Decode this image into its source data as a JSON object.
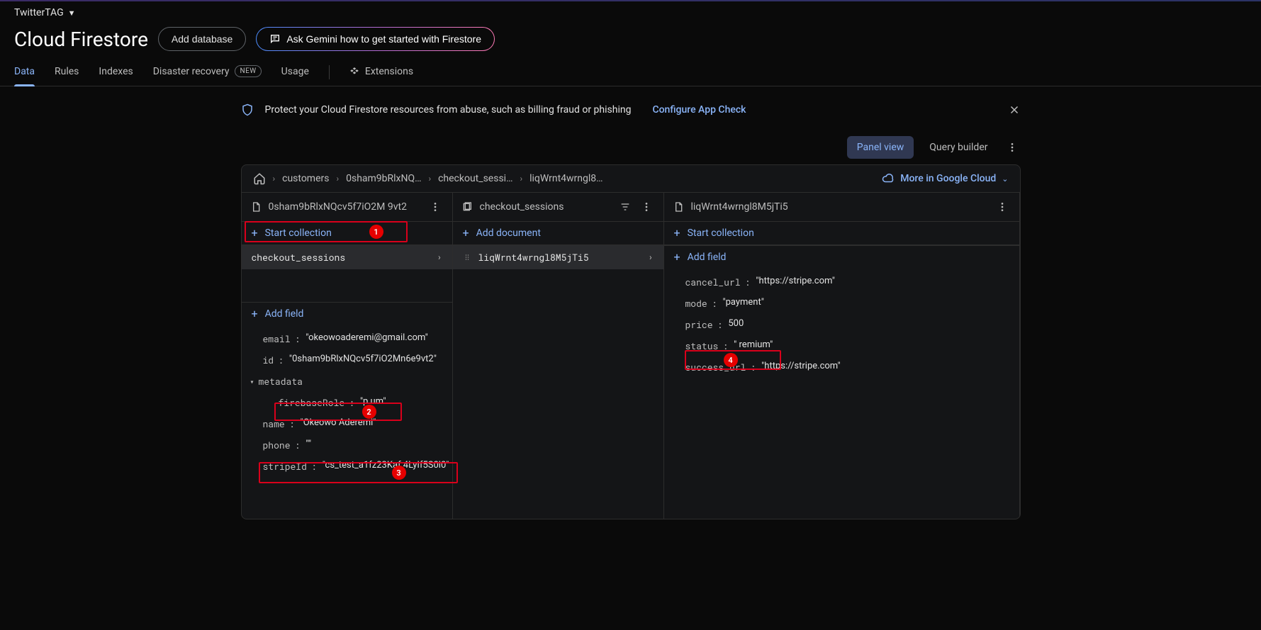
{
  "project": {
    "name": "TwitterTAG"
  },
  "page": {
    "title": "Cloud Firestore",
    "add_db": "Add database",
    "ask_gemini": "Ask Gemini how to get started with Firestore"
  },
  "tabs": {
    "data": "Data",
    "rules": "Rules",
    "indexes": "Indexes",
    "disaster": "Disaster recovery",
    "disaster_badge": "NEW",
    "usage": "Usage",
    "extensions": "Extensions"
  },
  "banner": {
    "text": "Protect your Cloud Firestore resources from abuse, such as billing fraud or phishing",
    "link": "Configure App Check"
  },
  "view": {
    "panel": "Panel view",
    "query": "Query builder"
  },
  "breadcrumb": {
    "c0": "customers",
    "c1": "0sham9bRlxNQ…",
    "c2": "checkout_sessi…",
    "c3": "liqWrnt4wrngl8…",
    "cloud": "More in Google Cloud"
  },
  "panel1": {
    "header": "0sham9bRlxNQcv5f7iO2M   9vt2",
    "start_collection": "Start collection",
    "collection0": "checkout_sessions",
    "add_field": "Add field",
    "fields": {
      "email_k": "email",
      "email_v": "\"okeowoaderemi@gmail.com\"",
      "id_k": "id",
      "id_v": "\"0sham9bRlxNQcv5f7iO2Mn6e9vt2\"",
      "metadata_k": "metadata",
      "fbrole_k": "firebaseRole",
      "fbrole_v": "\"p    um\"",
      "name_k": "name",
      "name_v": "\"Okeowo Aderemi\"",
      "phone_k": "phone",
      "phone_v": "\"\"",
      "stripe_k": "stripeId",
      "stripe_v": "\"cs_test_a1fz23Kaf   4LyIf5S0l0\""
    }
  },
  "panel2": {
    "header": "checkout_sessions",
    "add_doc": "Add document",
    "doc0": "liqWrnt4wrngl8M5jTi5"
  },
  "panel3": {
    "header": "liqWrnt4wrngl8M5jTi5",
    "start_collection": "Start collection",
    "add_field": "Add field",
    "fields": {
      "cancel_k": "cancel_url",
      "cancel_v": "\"https://stripe.com\"",
      "mode_k": "mode",
      "mode_v": "\"payment\"",
      "price_k": "price",
      "price_v": "500",
      "status_k": "status",
      "status_v": "\"   remium\"",
      "success_k": "success_url",
      "success_v": "\"https://stripe.com\""
    }
  },
  "annotations": {
    "a1": "1",
    "a2": "2",
    "a3": "3",
    "a4": "4"
  }
}
